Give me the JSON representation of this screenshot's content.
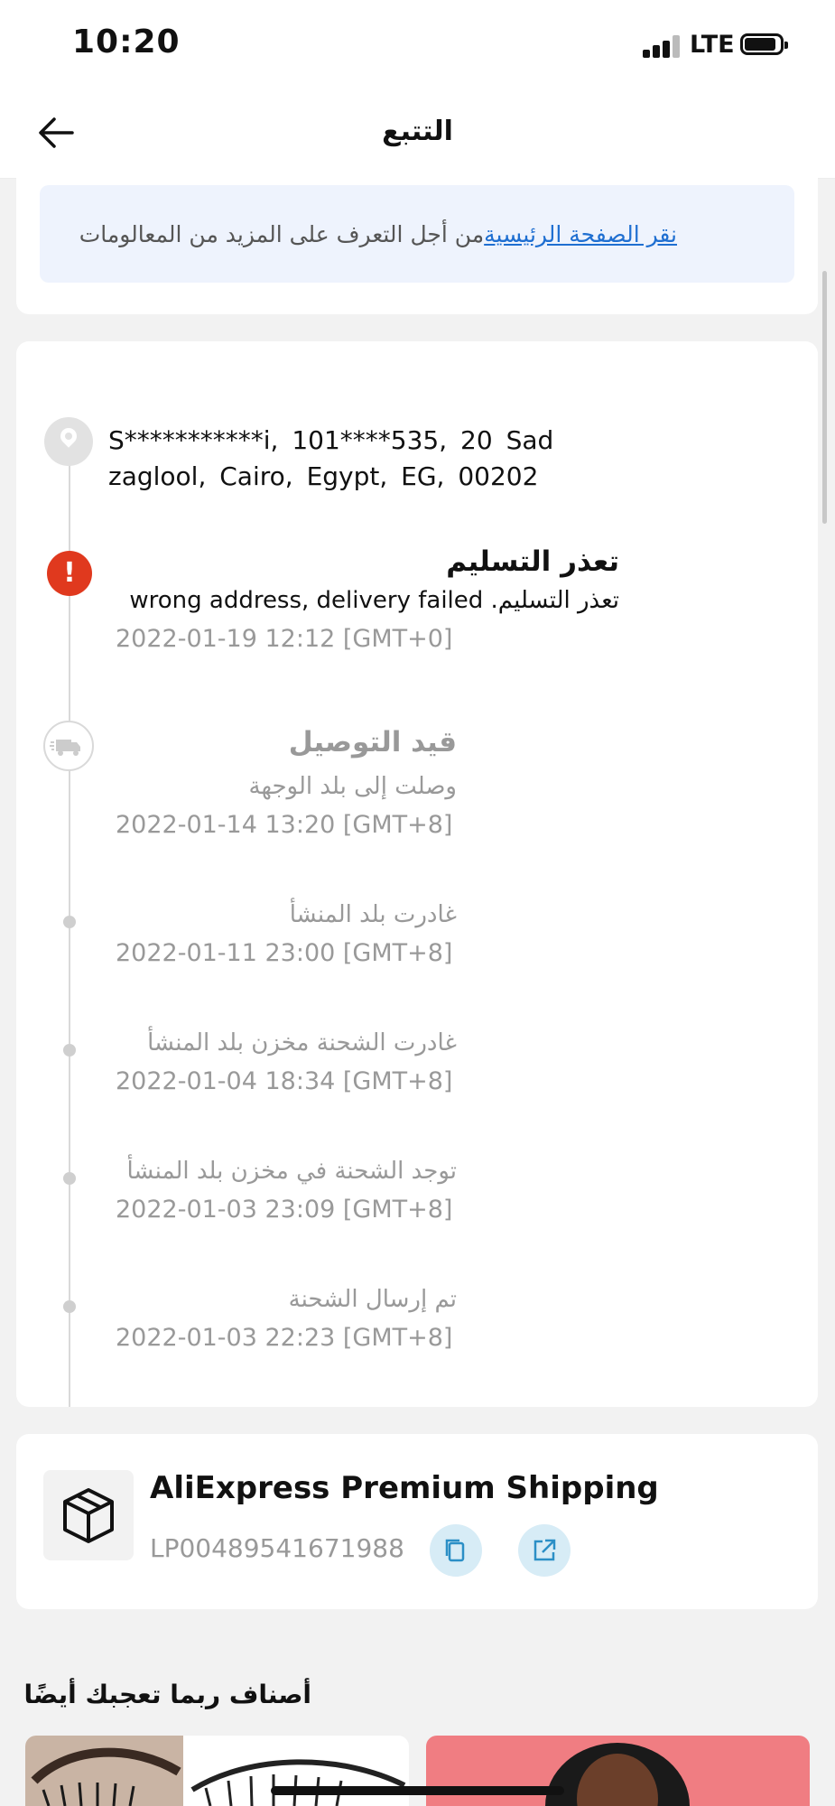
{
  "status_bar": {
    "time": "10:20",
    "network": "LTE"
  },
  "header": {
    "title": "التتبع"
  },
  "notice": {
    "link_text": "نقر الصفحة الرئيسية",
    "text": "من أجل التعرف على المزيد من المعالومات"
  },
  "address": "S***********i, 101****535, 20 Sad zaglool, Cairo, Egypt, EG, 00202",
  "events": [
    {
      "title": "تعذر التسليم",
      "description": "wrong address, delivery failed .تعذر التسليم",
      "time": "2022-01-19 12:12 [GMT+0]"
    },
    {
      "title": "قيد التوصيل",
      "description": "وصلت إلى بلد الوجهة",
      "time": "2022-01-14 13:20 [GMT+8]"
    },
    {
      "title": "",
      "description": "غادرت بلد المنشأ",
      "time": "2022-01-11 23:00 [GMT+8]"
    },
    {
      "title": "",
      "description": "غادرت الشحنة مخزن بلد المنشأ",
      "time": "2022-01-04 18:34 [GMT+8]"
    },
    {
      "title": "",
      "description": "توجد الشحنة في مخزن بلد المنشأ",
      "time": "2022-01-03 23:09 [GMT+8]"
    },
    {
      "title": "",
      "description": "تم إرسال الشحنة",
      "time": "2022-01-03 22:23 [GMT+8]"
    }
  ],
  "shipping": {
    "carrier": "AliExpress Premium Shipping",
    "tracking_number": "LP00489541671988"
  },
  "recommendations": {
    "title": "أصناف ربما تعجبك أيضًا"
  },
  "icons": [
    "back-arrow-icon",
    "location-pin-icon",
    "alert-icon",
    "truck-icon",
    "package-icon",
    "copy-icon",
    "external-link-icon"
  ],
  "colors": {
    "alert": "#e0391e",
    "link": "#1f6fd1",
    "notice_bg": "#eef3fd",
    "action_btn": "#d7ecf6",
    "action_icon": "#2b8fc6"
  }
}
